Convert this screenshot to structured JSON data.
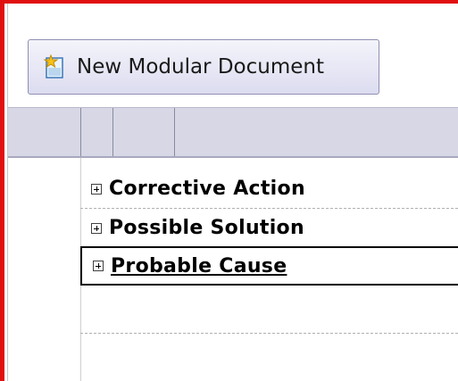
{
  "toolbar": {
    "new_document_label": "New Modular Document",
    "new_document_icon": "new-document-icon"
  },
  "tree": {
    "rows": [
      {
        "label": "Corrective Action",
        "expander": "+",
        "selected": false
      },
      {
        "label": "Possible Solution",
        "expander": "+",
        "selected": false
      },
      {
        "label": "Probable Cause",
        "expander": "+",
        "selected": true
      }
    ]
  },
  "colors": {
    "frame_border": "#e01010",
    "header_band": "#d7d7e6",
    "selection_border": "#000000"
  }
}
